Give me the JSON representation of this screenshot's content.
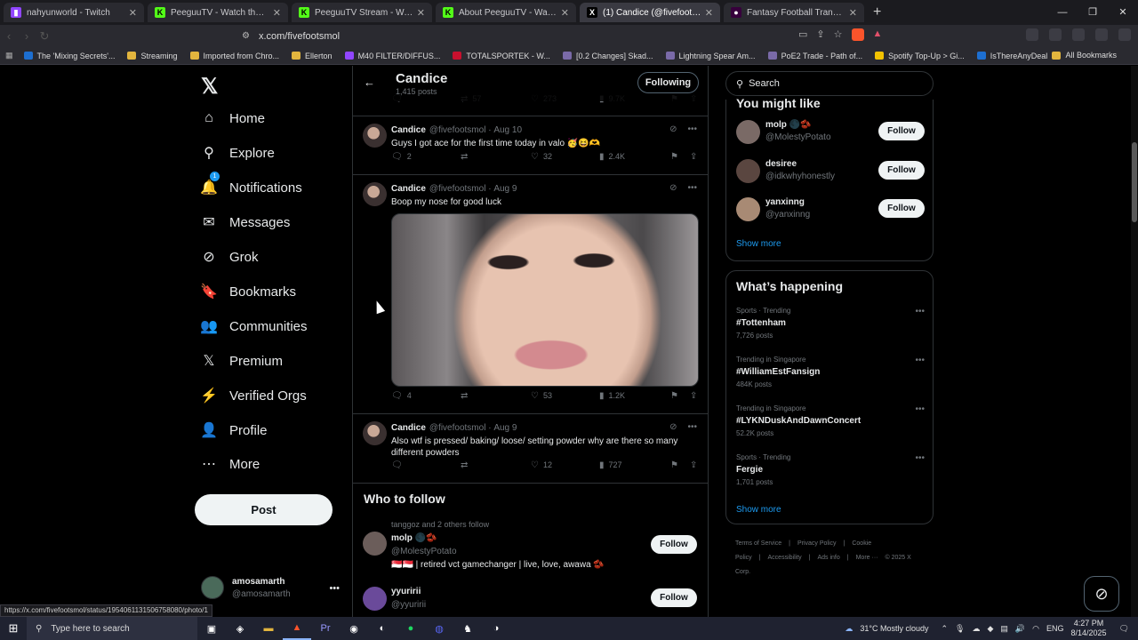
{
  "browser": {
    "tabs": [
      {
        "title": "nahyunworld - Twitch",
        "color": "#9146ff",
        "glyph": "▮",
        "active": false
      },
      {
        "title": "PeeguuTV - Watch the VOD on K",
        "color": "#53fc18",
        "glyph": "K",
        "active": false
      },
      {
        "title": "PeeguuTV Stream - Watch Live on K",
        "color": "#53fc18",
        "glyph": "K",
        "active": false
      },
      {
        "title": "About PeeguuTV - Watch Live on K",
        "color": "#53fc18",
        "glyph": "K",
        "active": false
      },
      {
        "title": "(1) Candice (@fivefootsmol) / X",
        "color": "#000000",
        "glyph": "X",
        "active": true
      },
      {
        "title": "Fantasy Football Transfers | Fantasy",
        "color": "#37003c",
        "glyph": "●",
        "active": false
      }
    ],
    "new_tab": "+",
    "url": "x.com/fivefootsmol",
    "bookmarks": [
      {
        "label": "The 'Mixing Secrets'...",
        "color": "#1d6fd1"
      },
      {
        "label": "Streaming",
        "color": "#e2b53e"
      },
      {
        "label": "Imported from Chro...",
        "color": "#e2b53e"
      },
      {
        "label": "Ellerton",
        "color": "#e2b53e"
      },
      {
        "label": "M40 FILTER/DIFFUS...",
        "color": "#9146ff"
      },
      {
        "label": "TOTALSPORTEK - W...",
        "color": "#c8102e"
      },
      {
        "label": "[0.2 Changes] Skad...",
        "color": "#7a6aa8"
      },
      {
        "label": "Lightning Spear Am...",
        "color": "#7a6aa8"
      },
      {
        "label": "PoE2 Trade - Path of...",
        "color": "#7a6aa8"
      },
      {
        "label": "Spotify Top-Up > Gi...",
        "color": "#f2c200"
      },
      {
        "label": "IsThereAnyDeal",
        "color": "#1d6fd1"
      }
    ],
    "all_bookmarks": "All Bookmarks",
    "status_url": "https://x.com/fivefootsmol/status/1954061131506758080/photo/1"
  },
  "nav": {
    "items": [
      {
        "label": "Home",
        "icon": "⌂",
        "name": "home"
      },
      {
        "label": "Explore",
        "icon": "⚲",
        "name": "explore"
      },
      {
        "label": "Notifications",
        "icon": "🔔",
        "name": "notifications"
      },
      {
        "label": "Messages",
        "icon": "✉",
        "name": "messages"
      },
      {
        "label": "Grok",
        "icon": "⊘",
        "name": "grok"
      },
      {
        "label": "Bookmarks",
        "icon": "🔖",
        "name": "bookmarks"
      },
      {
        "label": "Communities",
        "icon": "👥",
        "name": "communities"
      },
      {
        "label": "Premium",
        "icon": "𝕏",
        "name": "premium"
      },
      {
        "label": "Verified Orgs",
        "icon": "⚡",
        "name": "verified-orgs"
      },
      {
        "label": "Profile",
        "icon": "👤",
        "name": "profile"
      },
      {
        "label": "More",
        "icon": "⋯",
        "name": "more"
      }
    ],
    "notif_badge": "1",
    "post_label": "Post",
    "me_name": "amosamarth",
    "me_handle": "@amosamarth"
  },
  "profile": {
    "name": "Candice",
    "posts_count": "1,415 posts",
    "following_label": "Following"
  },
  "tweets": [
    {
      "replies": "",
      "retweets": "57",
      "likes": "273",
      "views": "9.7K"
    },
    {
      "name": "Candice",
      "handle": "@fivefootsmol",
      "date": "Aug 10",
      "text": "Guys I got ace for the first time today in valo 🥳😆🫶",
      "replies": "2",
      "retweets": "",
      "likes": "32",
      "views": "2.4K"
    },
    {
      "name": "Candice",
      "handle": "@fivefootsmol",
      "date": "Aug 9",
      "text": "Boop my nose for good luck",
      "replies": "4",
      "retweets": "",
      "likes": "53",
      "views": "1.2K"
    },
    {
      "name": "Candice",
      "handle": "@fivefootsmol",
      "date": "Aug 9",
      "text": "Also wtf is pressed/ baking/ loose/ setting powder why are there so many different powders",
      "replies": "",
      "retweets": "",
      "likes": "12",
      "views": "727"
    }
  ],
  "who_to_follow": {
    "title": "Who to follow",
    "context": "tanggoz and 2 others follow",
    "users": [
      {
        "name": "molp 🌑🫘",
        "handle": "@MolestyPotato",
        "bio": "🇸🇬🇸🇬 | retired vct gamechanger | live, love, awawa 🫘"
      },
      {
        "name": "yyuririi",
        "handle": "@yyuririi",
        "bio": ""
      }
    ],
    "follow_label": "Follow"
  },
  "sidebar": {
    "search_placeholder": "Search",
    "you_might_like": "You might like",
    "suggestions": [
      {
        "name": "molp 🌑🫘",
        "handle": "@MolestyPotato"
      },
      {
        "name": "desiree",
        "handle": "@idkwhyhonestly"
      },
      {
        "name": "yanxinng",
        "handle": "@yanxinng"
      }
    ],
    "follow_label": "Follow",
    "show_more": "Show more",
    "whats_happening": "What’s happening",
    "trends": [
      {
        "context": "Sports · Trending",
        "name": "#Tottenham",
        "posts": "7,726 posts"
      },
      {
        "context": "Trending in Singapore",
        "name": "#WilliamEstFansign",
        "posts": "484K posts"
      },
      {
        "context": "Trending in Singapore",
        "name": "#LYKNDuskAndDawnConcert",
        "posts": "52.2K posts"
      },
      {
        "context": "Sports · Trending",
        "name": "Fergie",
        "posts": "1,701 posts"
      }
    ],
    "show_more_2": "Show more",
    "footer": [
      "Terms of Service",
      "|",
      "Privacy Policy",
      "|",
      "Cookie Policy",
      "|",
      "Accessibility",
      "|",
      "Ads info",
      "|",
      "More ···",
      "© 2025 X Corp."
    ]
  },
  "taskbar": {
    "search_placeholder": "Type here to search",
    "weather": "31°C  Mostly cloudy",
    "lang": "ENG",
    "time": "4:27 PM",
    "date": "8/14/2025"
  }
}
